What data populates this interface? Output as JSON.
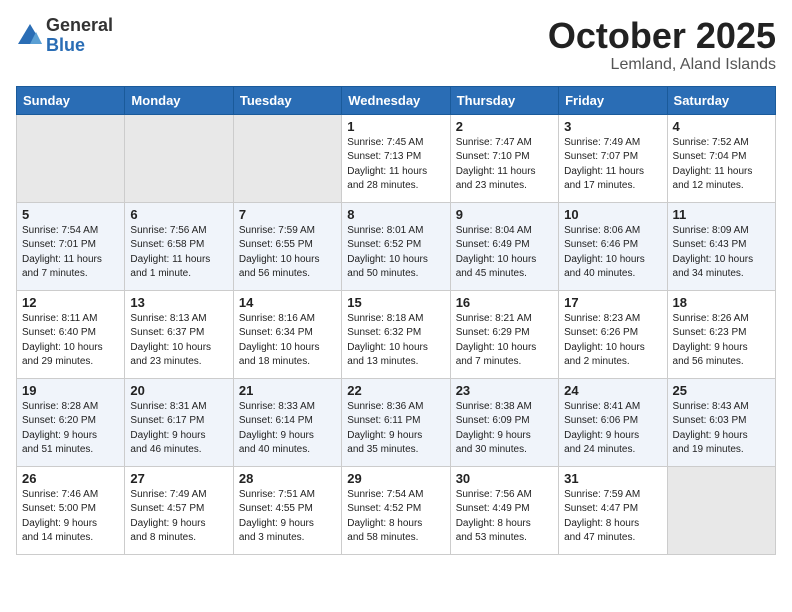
{
  "logo": {
    "general": "General",
    "blue": "Blue"
  },
  "title": {
    "month": "October 2025",
    "location": "Lemland, Aland Islands"
  },
  "days_of_week": [
    "Sunday",
    "Monday",
    "Tuesday",
    "Wednesday",
    "Thursday",
    "Friday",
    "Saturday"
  ],
  "weeks": [
    [
      {
        "day": "",
        "info": ""
      },
      {
        "day": "",
        "info": ""
      },
      {
        "day": "",
        "info": ""
      },
      {
        "day": "1",
        "info": "Sunrise: 7:45 AM\nSunset: 7:13 PM\nDaylight: 11 hours\nand 28 minutes."
      },
      {
        "day": "2",
        "info": "Sunrise: 7:47 AM\nSunset: 7:10 PM\nDaylight: 11 hours\nand 23 minutes."
      },
      {
        "day": "3",
        "info": "Sunrise: 7:49 AM\nSunset: 7:07 PM\nDaylight: 11 hours\nand 17 minutes."
      },
      {
        "day": "4",
        "info": "Sunrise: 7:52 AM\nSunset: 7:04 PM\nDaylight: 11 hours\nand 12 minutes."
      }
    ],
    [
      {
        "day": "5",
        "info": "Sunrise: 7:54 AM\nSunset: 7:01 PM\nDaylight: 11 hours\nand 7 minutes."
      },
      {
        "day": "6",
        "info": "Sunrise: 7:56 AM\nSunset: 6:58 PM\nDaylight: 11 hours\nand 1 minute."
      },
      {
        "day": "7",
        "info": "Sunrise: 7:59 AM\nSunset: 6:55 PM\nDaylight: 10 hours\nand 56 minutes."
      },
      {
        "day": "8",
        "info": "Sunrise: 8:01 AM\nSunset: 6:52 PM\nDaylight: 10 hours\nand 50 minutes."
      },
      {
        "day": "9",
        "info": "Sunrise: 8:04 AM\nSunset: 6:49 PM\nDaylight: 10 hours\nand 45 minutes."
      },
      {
        "day": "10",
        "info": "Sunrise: 8:06 AM\nSunset: 6:46 PM\nDaylight: 10 hours\nand 40 minutes."
      },
      {
        "day": "11",
        "info": "Sunrise: 8:09 AM\nSunset: 6:43 PM\nDaylight: 10 hours\nand 34 minutes."
      }
    ],
    [
      {
        "day": "12",
        "info": "Sunrise: 8:11 AM\nSunset: 6:40 PM\nDaylight: 10 hours\nand 29 minutes."
      },
      {
        "day": "13",
        "info": "Sunrise: 8:13 AM\nSunset: 6:37 PM\nDaylight: 10 hours\nand 23 minutes."
      },
      {
        "day": "14",
        "info": "Sunrise: 8:16 AM\nSunset: 6:34 PM\nDaylight: 10 hours\nand 18 minutes."
      },
      {
        "day": "15",
        "info": "Sunrise: 8:18 AM\nSunset: 6:32 PM\nDaylight: 10 hours\nand 13 minutes."
      },
      {
        "day": "16",
        "info": "Sunrise: 8:21 AM\nSunset: 6:29 PM\nDaylight: 10 hours\nand 7 minutes."
      },
      {
        "day": "17",
        "info": "Sunrise: 8:23 AM\nSunset: 6:26 PM\nDaylight: 10 hours\nand 2 minutes."
      },
      {
        "day": "18",
        "info": "Sunrise: 8:26 AM\nSunset: 6:23 PM\nDaylight: 9 hours\nand 56 minutes."
      }
    ],
    [
      {
        "day": "19",
        "info": "Sunrise: 8:28 AM\nSunset: 6:20 PM\nDaylight: 9 hours\nand 51 minutes."
      },
      {
        "day": "20",
        "info": "Sunrise: 8:31 AM\nSunset: 6:17 PM\nDaylight: 9 hours\nand 46 minutes."
      },
      {
        "day": "21",
        "info": "Sunrise: 8:33 AM\nSunset: 6:14 PM\nDaylight: 9 hours\nand 40 minutes."
      },
      {
        "day": "22",
        "info": "Sunrise: 8:36 AM\nSunset: 6:11 PM\nDaylight: 9 hours\nand 35 minutes."
      },
      {
        "day": "23",
        "info": "Sunrise: 8:38 AM\nSunset: 6:09 PM\nDaylight: 9 hours\nand 30 minutes."
      },
      {
        "day": "24",
        "info": "Sunrise: 8:41 AM\nSunset: 6:06 PM\nDaylight: 9 hours\nand 24 minutes."
      },
      {
        "day": "25",
        "info": "Sunrise: 8:43 AM\nSunset: 6:03 PM\nDaylight: 9 hours\nand 19 minutes."
      }
    ],
    [
      {
        "day": "26",
        "info": "Sunrise: 7:46 AM\nSunset: 5:00 PM\nDaylight: 9 hours\nand 14 minutes."
      },
      {
        "day": "27",
        "info": "Sunrise: 7:49 AM\nSunset: 4:57 PM\nDaylight: 9 hours\nand 8 minutes."
      },
      {
        "day": "28",
        "info": "Sunrise: 7:51 AM\nSunset: 4:55 PM\nDaylight: 9 hours\nand 3 minutes."
      },
      {
        "day": "29",
        "info": "Sunrise: 7:54 AM\nSunset: 4:52 PM\nDaylight: 8 hours\nand 58 minutes."
      },
      {
        "day": "30",
        "info": "Sunrise: 7:56 AM\nSunset: 4:49 PM\nDaylight: 8 hours\nand 53 minutes."
      },
      {
        "day": "31",
        "info": "Sunrise: 7:59 AM\nSunset: 4:47 PM\nDaylight: 8 hours\nand 47 minutes."
      },
      {
        "day": "",
        "info": ""
      }
    ]
  ]
}
